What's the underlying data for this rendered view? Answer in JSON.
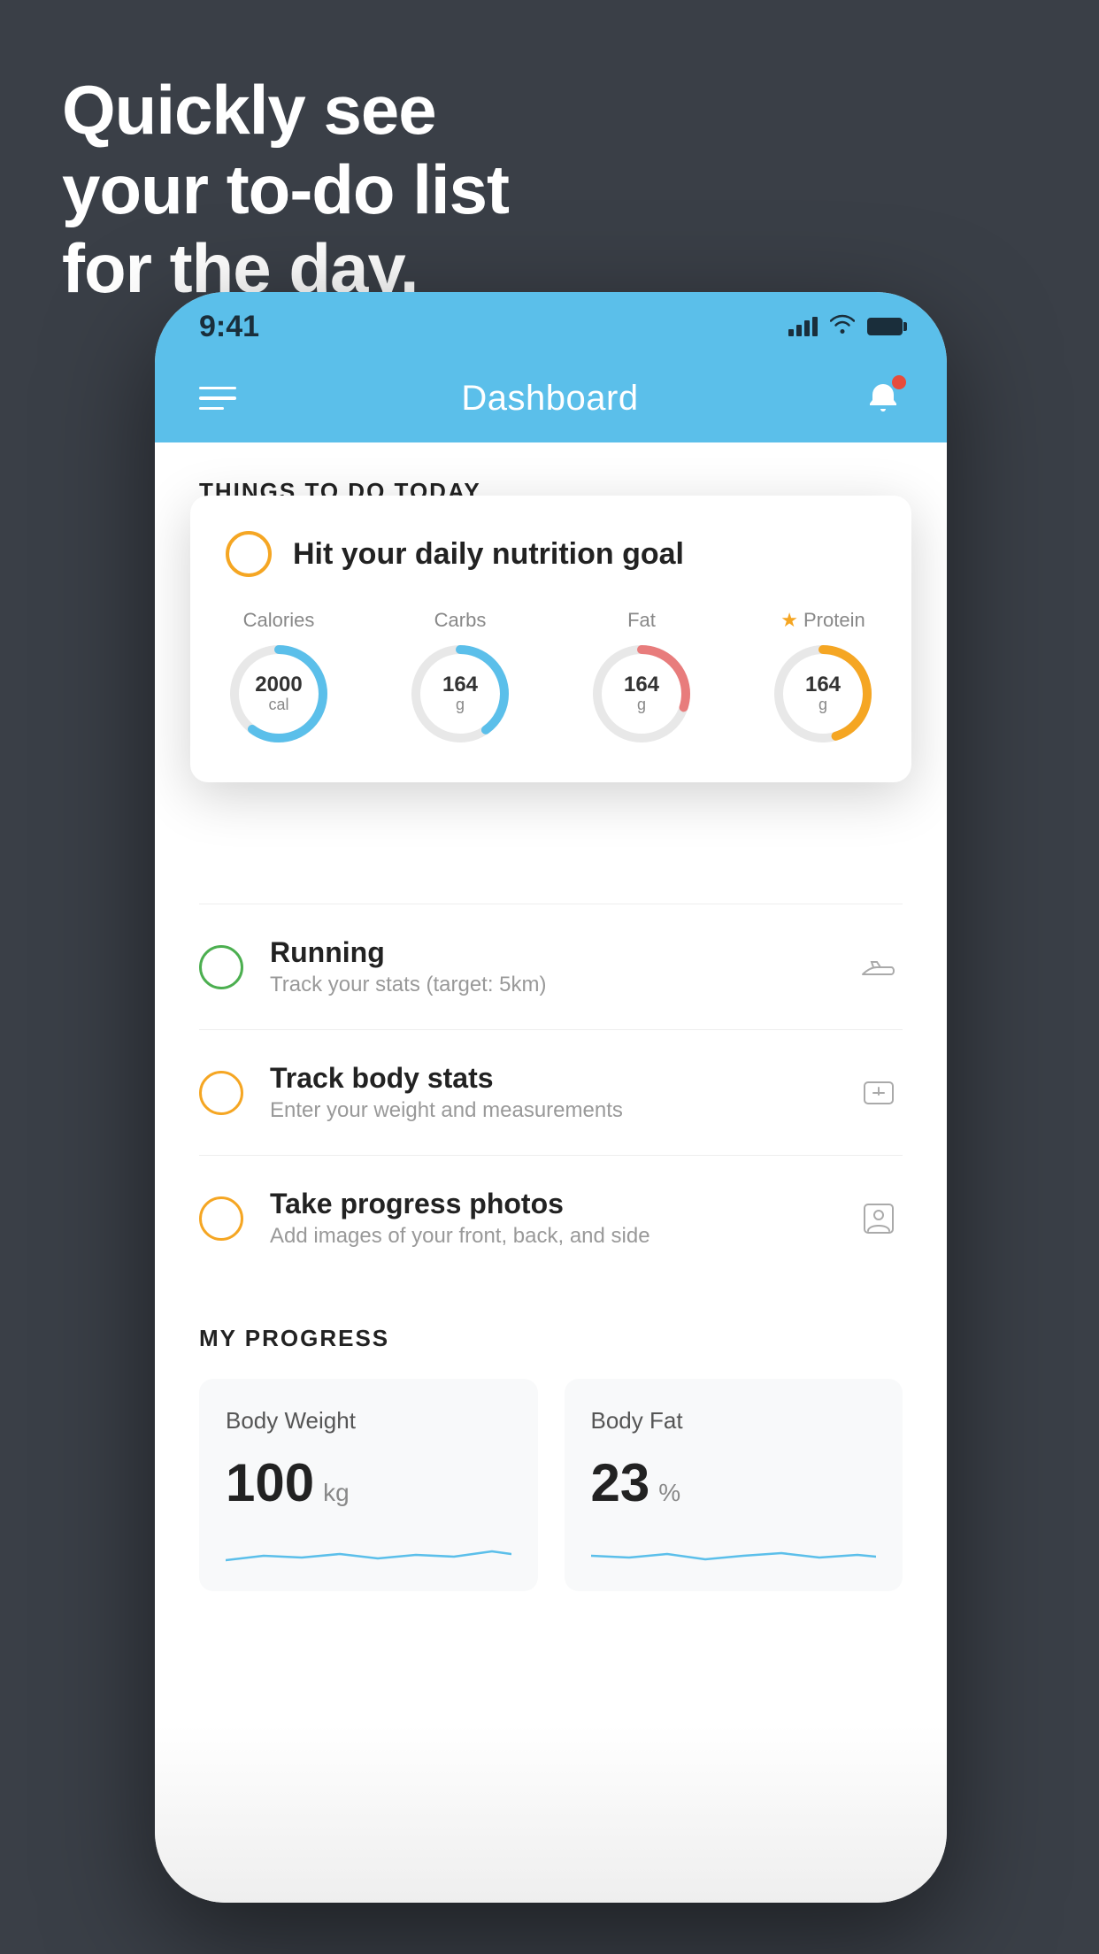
{
  "headline": {
    "line1": "Quickly see",
    "line2": "your to-do list",
    "line3": "for the day."
  },
  "status_bar": {
    "time": "9:41"
  },
  "nav": {
    "title": "Dashboard"
  },
  "section_header": "Things To Do Today",
  "floating_card": {
    "title": "Hit your daily nutrition goal",
    "nutrition": [
      {
        "label": "Calories",
        "value": "2000",
        "unit": "cal",
        "color": "calories",
        "offset": "40"
      },
      {
        "label": "Carbs",
        "value": "164",
        "unit": "g",
        "color": "carbs",
        "offset": "60"
      },
      {
        "label": "Fat",
        "value": "164",
        "unit": "g",
        "color": "fat",
        "offset": "70"
      },
      {
        "label": "Protein",
        "value": "164",
        "unit": "g",
        "color": "protein",
        "offset": "55",
        "star": true
      }
    ]
  },
  "todo_items": [
    {
      "title": "Running",
      "subtitle": "Track your stats (target: 5km)",
      "circle_color": "green",
      "icon": "shoe"
    },
    {
      "title": "Track body stats",
      "subtitle": "Enter your weight and measurements",
      "circle_color": "yellow",
      "icon": "scale"
    },
    {
      "title": "Take progress photos",
      "subtitle": "Add images of your front, back, and side",
      "circle_color": "yellow",
      "icon": "person"
    }
  ],
  "progress_section": {
    "header": "My Progress",
    "cards": [
      {
        "title": "Body Weight",
        "value": "100",
        "unit": "kg"
      },
      {
        "title": "Body Fat",
        "value": "23",
        "unit": "%"
      }
    ]
  }
}
